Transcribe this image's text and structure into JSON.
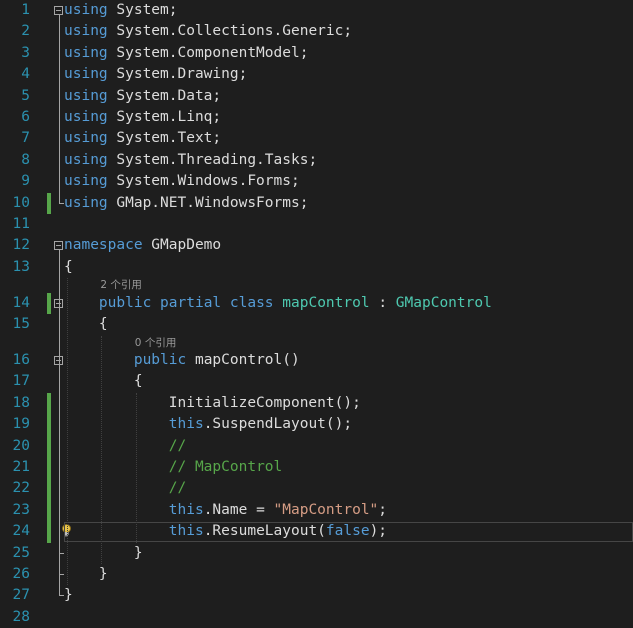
{
  "colors": {
    "background": "#1e1e1e",
    "keyword": "#569cd6",
    "type": "#4ec9b0",
    "string": "#d69d85",
    "comment": "#57a64a",
    "plain": "#dcdcdc",
    "line_number": "#2b91af",
    "change_bar": "#57a64a"
  },
  "editor": {
    "lines": [
      {
        "n": "1",
        "tokens": [
          {
            "t": "using",
            "c": "keyword"
          },
          {
            "t": " System;",
            "c": "plain"
          }
        ]
      },
      {
        "n": "2",
        "tokens": [
          {
            "t": "using",
            "c": "keyword"
          },
          {
            "t": " System.Collections.Generic;",
            "c": "plain"
          }
        ]
      },
      {
        "n": "3",
        "tokens": [
          {
            "t": "using",
            "c": "keyword"
          },
          {
            "t": " System.ComponentModel;",
            "c": "plain"
          }
        ]
      },
      {
        "n": "4",
        "tokens": [
          {
            "t": "using",
            "c": "keyword"
          },
          {
            "t": " System.Drawing;",
            "c": "plain"
          }
        ]
      },
      {
        "n": "5",
        "tokens": [
          {
            "t": "using",
            "c": "keyword"
          },
          {
            "t": " System.Data;",
            "c": "plain"
          }
        ]
      },
      {
        "n": "6",
        "tokens": [
          {
            "t": "using",
            "c": "keyword"
          },
          {
            "t": " System.Linq;",
            "c": "plain"
          }
        ]
      },
      {
        "n": "7",
        "tokens": [
          {
            "t": "using",
            "c": "keyword"
          },
          {
            "t": " System.Text;",
            "c": "plain"
          }
        ]
      },
      {
        "n": "8",
        "tokens": [
          {
            "t": "using",
            "c": "keyword"
          },
          {
            "t": " System.Threading.Tasks;",
            "c": "plain"
          }
        ]
      },
      {
        "n": "9",
        "tokens": [
          {
            "t": "using",
            "c": "keyword"
          },
          {
            "t": " System.Windows.Forms;",
            "c": "plain"
          }
        ]
      },
      {
        "n": "10",
        "tokens": [
          {
            "t": "using",
            "c": "keyword"
          },
          {
            "t": " GMap.NET.WindowsForms;",
            "c": "plain"
          }
        ]
      },
      {
        "n": "11",
        "tokens": []
      },
      {
        "n": "12",
        "tokens": [
          {
            "t": "namespace",
            "c": "keyword"
          },
          {
            "t": " GMapDemo",
            "c": "plain"
          }
        ]
      },
      {
        "n": "13",
        "tokens": [
          {
            "t": "{",
            "c": "plain"
          }
        ]
      },
      {
        "n": "14",
        "codelens": "2 个引用",
        "tokens": [
          {
            "t": "    ",
            "c": "plain"
          },
          {
            "t": "public",
            "c": "keyword"
          },
          {
            "t": " ",
            "c": "plain"
          },
          {
            "t": "partial",
            "c": "keyword"
          },
          {
            "t": " ",
            "c": "plain"
          },
          {
            "t": "class",
            "c": "keyword"
          },
          {
            "t": " ",
            "c": "plain"
          },
          {
            "t": "mapControl",
            "c": "type"
          },
          {
            "t": " : ",
            "c": "plain"
          },
          {
            "t": "GMapControl",
            "c": "type"
          }
        ]
      },
      {
        "n": "15",
        "tokens": [
          {
            "t": "    {",
            "c": "plain"
          }
        ]
      },
      {
        "n": "16",
        "codelens": "0 个引用",
        "tokens": [
          {
            "t": "        ",
            "c": "plain"
          },
          {
            "t": "public",
            "c": "keyword"
          },
          {
            "t": " mapControl()",
            "c": "plain"
          }
        ]
      },
      {
        "n": "17",
        "tokens": [
          {
            "t": "        {",
            "c": "plain"
          }
        ]
      },
      {
        "n": "18",
        "tokens": [
          {
            "t": "            InitializeComponent();",
            "c": "plain"
          }
        ]
      },
      {
        "n": "19",
        "tokens": [
          {
            "t": "            ",
            "c": "plain"
          },
          {
            "t": "this",
            "c": "keyword"
          },
          {
            "t": ".SuspendLayout();",
            "c": "plain"
          }
        ]
      },
      {
        "n": "20",
        "tokens": [
          {
            "t": "            ",
            "c": "plain"
          },
          {
            "t": "//",
            "c": "comment"
          }
        ]
      },
      {
        "n": "21",
        "tokens": [
          {
            "t": "            ",
            "c": "plain"
          },
          {
            "t": "// MapControl",
            "c": "comment"
          }
        ]
      },
      {
        "n": "22",
        "tokens": [
          {
            "t": "            ",
            "c": "plain"
          },
          {
            "t": "//",
            "c": "comment"
          }
        ]
      },
      {
        "n": "23",
        "tokens": [
          {
            "t": "            ",
            "c": "plain"
          },
          {
            "t": "this",
            "c": "keyword"
          },
          {
            "t": ".Name = ",
            "c": "plain"
          },
          {
            "t": "\"MapControl\"",
            "c": "string"
          },
          {
            "t": ";",
            "c": "plain"
          }
        ]
      },
      {
        "n": "24",
        "tokens": [
          {
            "t": "            ",
            "c": "plain"
          },
          {
            "t": "this",
            "c": "keyword"
          },
          {
            "t": ".ResumeLayout(",
            "c": "plain"
          },
          {
            "t": "false",
            "c": "keyword"
          },
          {
            "t": ");",
            "c": "plain"
          }
        ]
      },
      {
        "n": "25",
        "tokens": [
          {
            "t": "        }",
            "c": "plain"
          }
        ]
      },
      {
        "n": "26",
        "tokens": [
          {
            "t": "    }",
            "c": "plain"
          }
        ]
      },
      {
        "n": "27",
        "tokens": [
          {
            "t": "}",
            "c": "plain"
          }
        ]
      },
      {
        "n": "28",
        "tokens": []
      }
    ]
  }
}
